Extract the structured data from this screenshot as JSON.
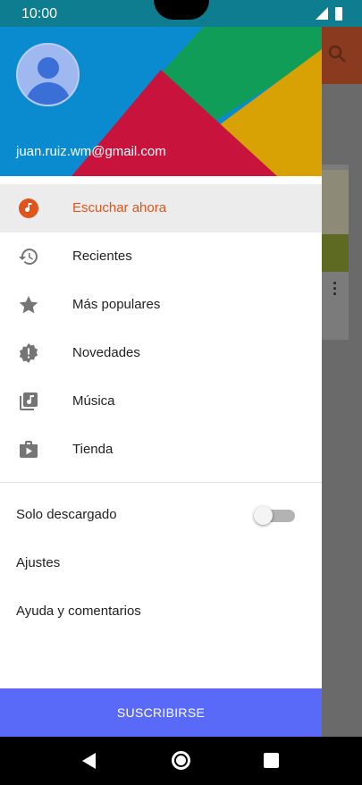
{
  "status_bar": {
    "time": "10:00"
  },
  "account": {
    "email": "juan.ruiz.wm@gmail.com"
  },
  "menu": {
    "items": [
      {
        "label": "Escuchar ahora",
        "icon": "music-note-icon",
        "active": true
      },
      {
        "label": "Recientes",
        "icon": "history-icon",
        "active": false
      },
      {
        "label": "Más populares",
        "icon": "star-icon",
        "active": false
      },
      {
        "label": "Novedades",
        "icon": "new-badge-icon",
        "active": false
      },
      {
        "label": "Música",
        "icon": "music-library-icon",
        "active": false
      },
      {
        "label": "Tienda",
        "icon": "store-icon",
        "active": false
      }
    ]
  },
  "settings": {
    "downloaded_only_label": "Solo descargado",
    "downloaded_only_on": false,
    "settings_label": "Ajustes",
    "help_label": "Ayuda y comentarios"
  },
  "subscribe": {
    "label": "SUSCRIBIRSE"
  },
  "colors": {
    "accent": "#e0531b",
    "subscribe": "#5a6af8",
    "header_blue": "#0b8bcf",
    "header_green": "#0f9d58",
    "header_red": "#c8133d",
    "header_yellow": "#d8a104"
  },
  "background_app": {
    "icons": [
      "search-icon",
      "more-vert-icon"
    ]
  }
}
